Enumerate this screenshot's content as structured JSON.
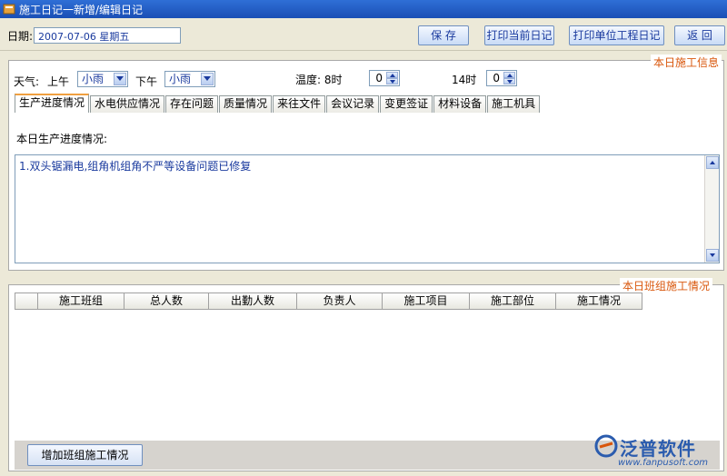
{
  "window": {
    "title": "施工日记一新增/编辑日记"
  },
  "toolbar": {
    "date_label": "日期:",
    "date_value": "2007-07-06   星期五",
    "save_label": "保 存",
    "print_current_label": "打印当前日记",
    "print_project_label": "打印单位工程日记",
    "back_label": "返 回"
  },
  "daily_info": {
    "legend": "本日施工信息",
    "weather_label": "天气:",
    "am_label": "上午",
    "am_value": "小雨",
    "pm_label": "下午",
    "pm_value": "小雨",
    "temp_label": "温度: 8时",
    "temp_8_value": "0",
    "temp_14_label": "14时",
    "temp_14_value": "0",
    "tabs": [
      {
        "label": "生产进度情况"
      },
      {
        "label": "水电供应情况"
      },
      {
        "label": "存在问题"
      },
      {
        "label": "质量情况"
      },
      {
        "label": "来往文件"
      },
      {
        "label": "会议记录"
      },
      {
        "label": "变更签证"
      },
      {
        "label": "材料设备"
      },
      {
        "label": "施工机具"
      }
    ],
    "active_tab": "生产进度情况",
    "content_label": "本日生产进度情况:",
    "content_text": "1.双头锯漏电,组角机组角不严等设备问题已修复"
  },
  "team_info": {
    "legend": "本日班组施工情况",
    "columns": [
      "施工班组",
      "总人数",
      "出勤人数",
      "负责人",
      "施工项目",
      "施工部位",
      "施工情况"
    ],
    "rows": [],
    "add_button_label": "增加班组施工情况"
  },
  "watermark": {
    "brand": "泛普软件",
    "url": "www.fanpusoft.com"
  },
  "colors": {
    "accent": "#d9560b",
    "link_text": "#1a3a9e",
    "title_bar": "#2f6fd6"
  }
}
